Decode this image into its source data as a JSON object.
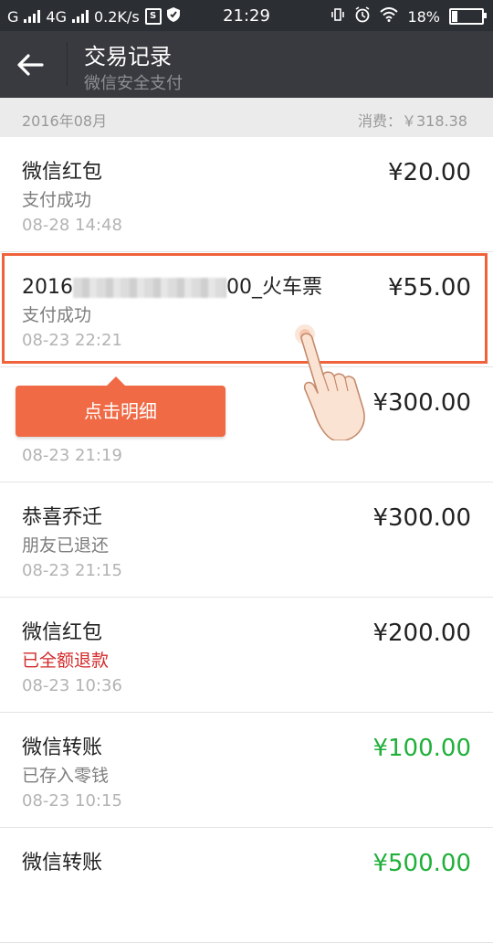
{
  "status_bar": {
    "carrier": "G",
    "network": "4G",
    "speed": "0.2K/s",
    "time": "21:29",
    "battery": "18%"
  },
  "header": {
    "title": "交易记录",
    "subtitle": "微信安全支付"
  },
  "month_bar": {
    "month": "2016年08月",
    "spend": "消费：￥318.38"
  },
  "transactions": [
    {
      "name": "微信红包",
      "status": "支付成功",
      "date": "08-28 14:48",
      "amount": "¥20.00",
      "amount_color": "#222222"
    },
    {
      "name_prefix": "2016",
      "name_suffix": "00_火车票",
      "status": "支付成功",
      "date": "08-23 22:21",
      "amount": "¥55.00",
      "amount_color": "#222222"
    },
    {
      "name": "",
      "status": "",
      "date": "08-23 21:19",
      "amount": "¥300.00",
      "amount_color": "#222222"
    },
    {
      "name": "恭喜乔迁",
      "status": "朋友已退还",
      "date": "08-23 21:15",
      "amount": "¥300.00",
      "amount_color": "#222222"
    },
    {
      "name": "微信红包",
      "status": "已全额退款",
      "status_color": "#d32a2a",
      "date": "08-23 10:36",
      "amount": "¥200.00",
      "amount_color": "#222222"
    },
    {
      "name": "微信转账",
      "status": "已存入零钱",
      "date": "08-23 10:15",
      "amount": "¥100.00",
      "amount_color": "#20b03a"
    },
    {
      "name": "微信转账",
      "status": "",
      "date": "",
      "amount": "¥500.00",
      "amount_color": "#20b03a"
    }
  ],
  "tooltip": {
    "label": "点击明细"
  },
  "colors": {
    "accent": "#ef6a45",
    "positive": "#20b03a",
    "refund": "#d32a2a",
    "header_bg": "#393a3f"
  },
  "icons": {
    "back": "back-arrow-icon",
    "pointer": "pointing-hand-icon"
  }
}
